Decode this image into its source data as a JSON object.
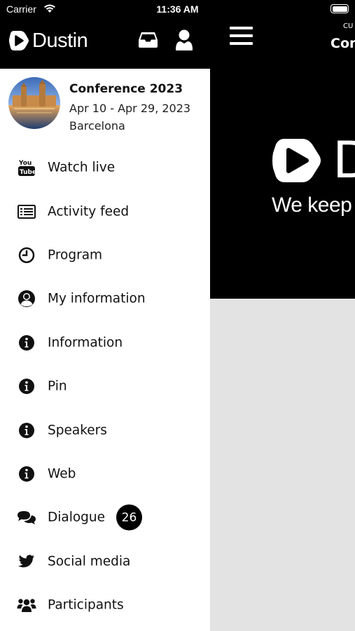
{
  "status_bar": {
    "carrier": "Carrier",
    "time": "11:36 AM"
  },
  "main": {
    "subtitle": "CU",
    "title": "Con",
    "hero_tagline": "We keep"
  },
  "drawer": {
    "brand_name": "Dustin",
    "event": {
      "title": "Conference 2023",
      "dates": "Apr 10 - Apr 29, 2023",
      "location": "Barcelona"
    },
    "menu": [
      {
        "label": "Watch live",
        "icon": "youtube-icon"
      },
      {
        "label": "Activity feed",
        "icon": "list-icon"
      },
      {
        "label": "Program",
        "icon": "clock-icon"
      },
      {
        "label": "My information",
        "icon": "user-circle-icon"
      },
      {
        "label": "Information",
        "icon": "info-icon"
      },
      {
        "label": "Pin",
        "icon": "info-icon"
      },
      {
        "label": "Speakers",
        "icon": "info-icon"
      },
      {
        "label": "Web",
        "icon": "info-icon"
      },
      {
        "label": "Dialogue",
        "icon": "comments-icon",
        "badge": "26"
      },
      {
        "label": "Social media",
        "icon": "twitter-icon"
      },
      {
        "label": "Participants",
        "icon": "users-icon"
      }
    ]
  },
  "colors": {
    "header_bg": "#000000",
    "drawer_bg": "#ffffff",
    "content_bg": "#e3e3e3",
    "badge_bg": "#000000"
  }
}
